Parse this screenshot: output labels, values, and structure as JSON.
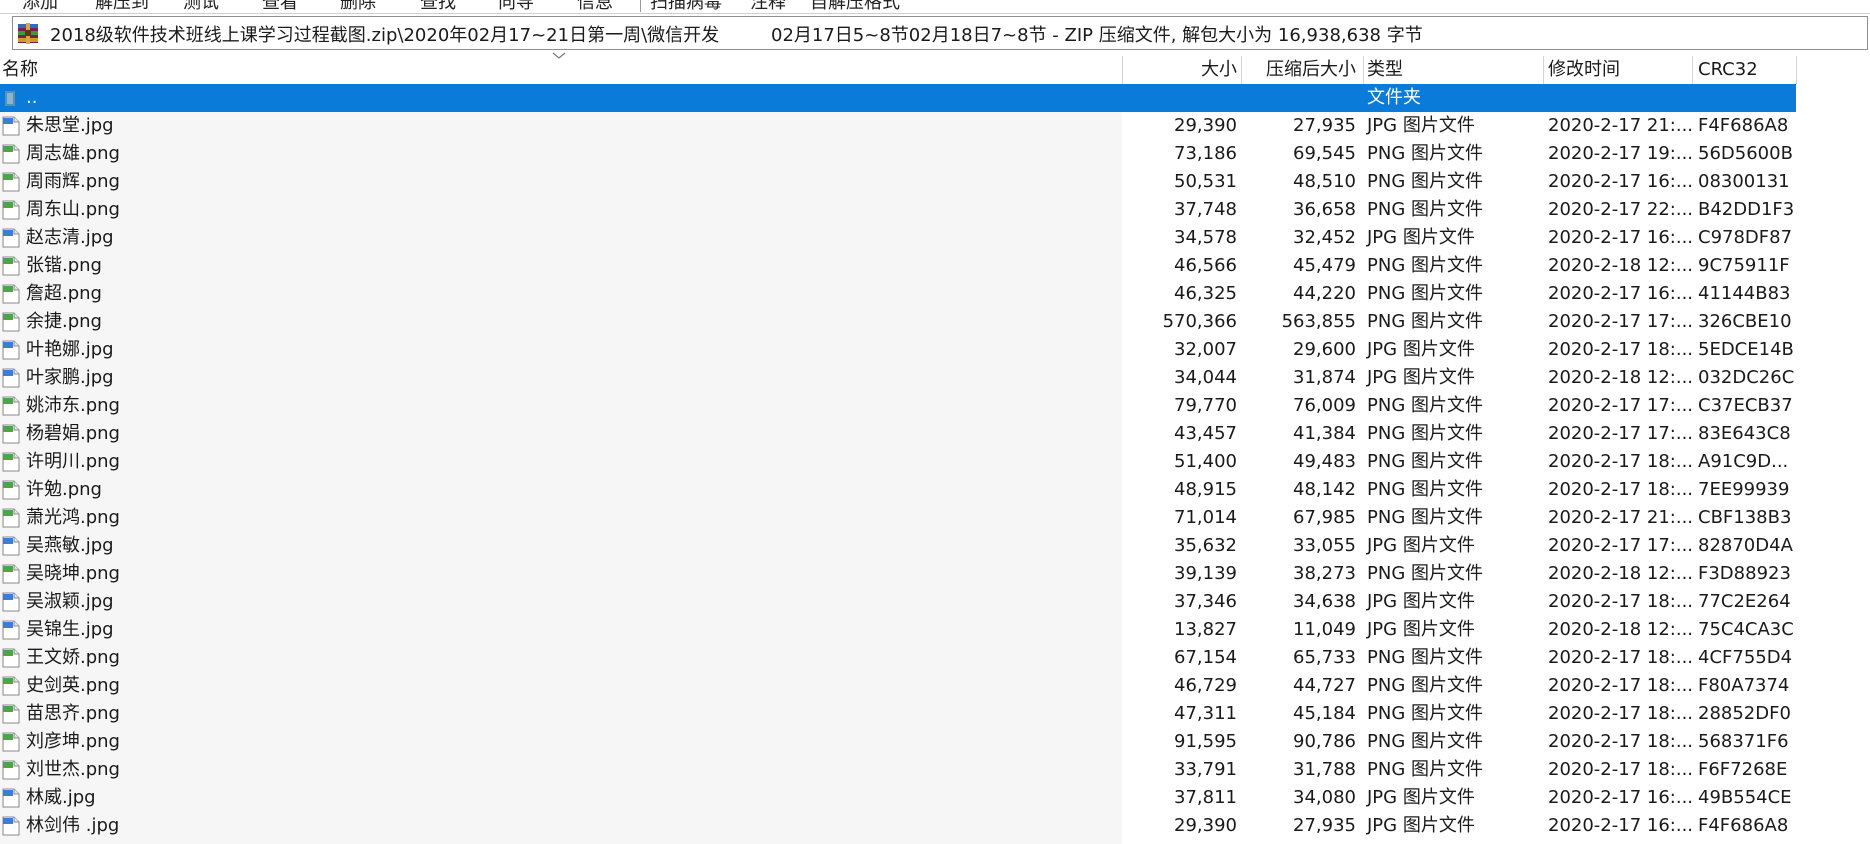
{
  "toolbar": {
    "items": [
      "添加",
      "解压到",
      "测试",
      "查看",
      "删除",
      "查找",
      "向导",
      "信息",
      "扫描病毒",
      "注释",
      "自解压格式"
    ]
  },
  "address": {
    "path": "2018级软件技术班线上课学习过程截图.zip\\2020年02月17~21日第一周\\微信开发",
    "description": "02月17日5~8节02月18日7~8节 - ZIP 压缩文件, 解包大小为 16,938,638 字节",
    "archive_icon": "winrar-archive-icon"
  },
  "columns": {
    "name": "名称",
    "size": "大小",
    "packed": "压缩后大小",
    "type": "类型",
    "modified": "修改时间",
    "crc": "CRC32"
  },
  "colors": {
    "selection": "#0a7bd8",
    "name_column_bg": "#f6f6f6",
    "jpg_icon_accent": "#3b7fd4",
    "png_icon_accent": "#4aa64a"
  },
  "files": [
    {
      "name": "..",
      "size": "",
      "packed": "",
      "type": "文件夹",
      "modified": "",
      "crc": "",
      "icon": "folder-up-icon",
      "selected": true
    },
    {
      "name": "朱思堂.jpg",
      "size": "29,390",
      "packed": "27,935",
      "type": "JPG 图片文件",
      "modified": "2020-2-17 21:...",
      "crc": "F4F686A8",
      "icon": "jpg-file-icon"
    },
    {
      "name": "周志雄.png",
      "size": "73,186",
      "packed": "69,545",
      "type": "PNG 图片文件",
      "modified": "2020-2-17 19:...",
      "crc": "56D5600B",
      "icon": "png-file-icon"
    },
    {
      "name": "周雨辉.png",
      "size": "50,531",
      "packed": "48,510",
      "type": "PNG 图片文件",
      "modified": "2020-2-17 16:...",
      "crc": "08300131",
      "icon": "png-file-icon"
    },
    {
      "name": "周东山.png",
      "size": "37,748",
      "packed": "36,658",
      "type": "PNG 图片文件",
      "modified": "2020-2-17 22:...",
      "crc": "B42DD1F3",
      "icon": "png-file-icon"
    },
    {
      "name": "赵志清.jpg",
      "size": "34,578",
      "packed": "32,452",
      "type": "JPG 图片文件",
      "modified": "2020-2-17 16:...",
      "crc": "C978DF87",
      "icon": "jpg-file-icon"
    },
    {
      "name": "张锴.png",
      "size": "46,566",
      "packed": "45,479",
      "type": "PNG 图片文件",
      "modified": "2020-2-18 12:...",
      "crc": "9C75911F",
      "icon": "png-file-icon"
    },
    {
      "name": "詹超.png",
      "size": "46,325",
      "packed": "44,220",
      "type": "PNG 图片文件",
      "modified": "2020-2-17 16:...",
      "crc": "41144B83",
      "icon": "png-file-icon"
    },
    {
      "name": "余捷.png",
      "size": "570,366",
      "packed": "563,855",
      "type": "PNG 图片文件",
      "modified": "2020-2-17 17:...",
      "crc": "326CBE10",
      "icon": "png-file-icon"
    },
    {
      "name": "叶艳娜.jpg",
      "size": "32,007",
      "packed": "29,600",
      "type": "JPG 图片文件",
      "modified": "2020-2-17 18:...",
      "crc": "5EDCE14B",
      "icon": "jpg-file-icon"
    },
    {
      "name": "叶家鹏.jpg",
      "size": "34,044",
      "packed": "31,874",
      "type": "JPG 图片文件",
      "modified": "2020-2-18 12:...",
      "crc": "032DC26C",
      "icon": "jpg-file-icon"
    },
    {
      "name": "姚沛东.png",
      "size": "79,770",
      "packed": "76,009",
      "type": "PNG 图片文件",
      "modified": "2020-2-17 17:...",
      "crc": "C37ECB37",
      "icon": "png-file-icon"
    },
    {
      "name": "杨碧娟.png",
      "size": "43,457",
      "packed": "41,384",
      "type": "PNG 图片文件",
      "modified": "2020-2-17 17:...",
      "crc": "83E643C8",
      "icon": "png-file-icon"
    },
    {
      "name": "许明川.png",
      "size": "51,400",
      "packed": "49,483",
      "type": "PNG 图片文件",
      "modified": "2020-2-17 18:...",
      "crc": "A91C9D...",
      "icon": "png-file-icon"
    },
    {
      "name": "许勉.png",
      "size": "48,915",
      "packed": "48,142",
      "type": "PNG 图片文件",
      "modified": "2020-2-17 18:...",
      "crc": "7EE99939",
      "icon": "png-file-icon"
    },
    {
      "name": "萧光鸿.png",
      "size": "71,014",
      "packed": "67,985",
      "type": "PNG 图片文件",
      "modified": "2020-2-17 21:...",
      "crc": "CBF138B3",
      "icon": "png-file-icon"
    },
    {
      "name": "吴燕敏.jpg",
      "size": "35,632",
      "packed": "33,055",
      "type": "JPG 图片文件",
      "modified": "2020-2-17 17:...",
      "crc": "82870D4A",
      "icon": "jpg-file-icon"
    },
    {
      "name": "吴晓坤.png",
      "size": "39,139",
      "packed": "38,273",
      "type": "PNG 图片文件",
      "modified": "2020-2-18 12:...",
      "crc": "F3D88923",
      "icon": "png-file-icon"
    },
    {
      "name": "吴淑颖.jpg",
      "size": "37,346",
      "packed": "34,638",
      "type": "JPG 图片文件",
      "modified": "2020-2-17 18:...",
      "crc": "77C2E264",
      "icon": "jpg-file-icon"
    },
    {
      "name": "吴锦生.jpg",
      "size": "13,827",
      "packed": "11,049",
      "type": "JPG 图片文件",
      "modified": "2020-2-18 12:...",
      "crc": "75C4CA3C",
      "icon": "jpg-file-icon"
    },
    {
      "name": "王文娇.png",
      "size": "67,154",
      "packed": "65,733",
      "type": "PNG 图片文件",
      "modified": "2020-2-17 18:...",
      "crc": "4CF755D4",
      "icon": "png-file-icon"
    },
    {
      "name": "史剑英.png",
      "size": "46,729",
      "packed": "44,727",
      "type": "PNG 图片文件",
      "modified": "2020-2-17 18:...",
      "crc": "F80A7374",
      "icon": "png-file-icon"
    },
    {
      "name": "苗思齐.png",
      "size": "47,311",
      "packed": "45,184",
      "type": "PNG 图片文件",
      "modified": "2020-2-17 18:...",
      "crc": "28852DF0",
      "icon": "png-file-icon"
    },
    {
      "name": "刘彦坤.png",
      "size": "91,595",
      "packed": "90,786",
      "type": "PNG 图片文件",
      "modified": "2020-2-17 18:...",
      "crc": "568371F6",
      "icon": "png-file-icon"
    },
    {
      "name": "刘世杰.png",
      "size": "33,791",
      "packed": "31,788",
      "type": "PNG 图片文件",
      "modified": "2020-2-17 18:...",
      "crc": "F6F7268E",
      "icon": "png-file-icon"
    },
    {
      "name": "林威.jpg",
      "size": "37,811",
      "packed": "34,080",
      "type": "JPG 图片文件",
      "modified": "2020-2-17 16:...",
      "crc": "49B554CE",
      "icon": "jpg-file-icon"
    },
    {
      "name": "林剑伟 .jpg",
      "size": "29,390",
      "packed": "27,935",
      "type": "JPG 图片文件",
      "modified": "2020-2-17 16:...",
      "crc": "F4F686A8",
      "icon": "jpg-file-icon"
    }
  ]
}
